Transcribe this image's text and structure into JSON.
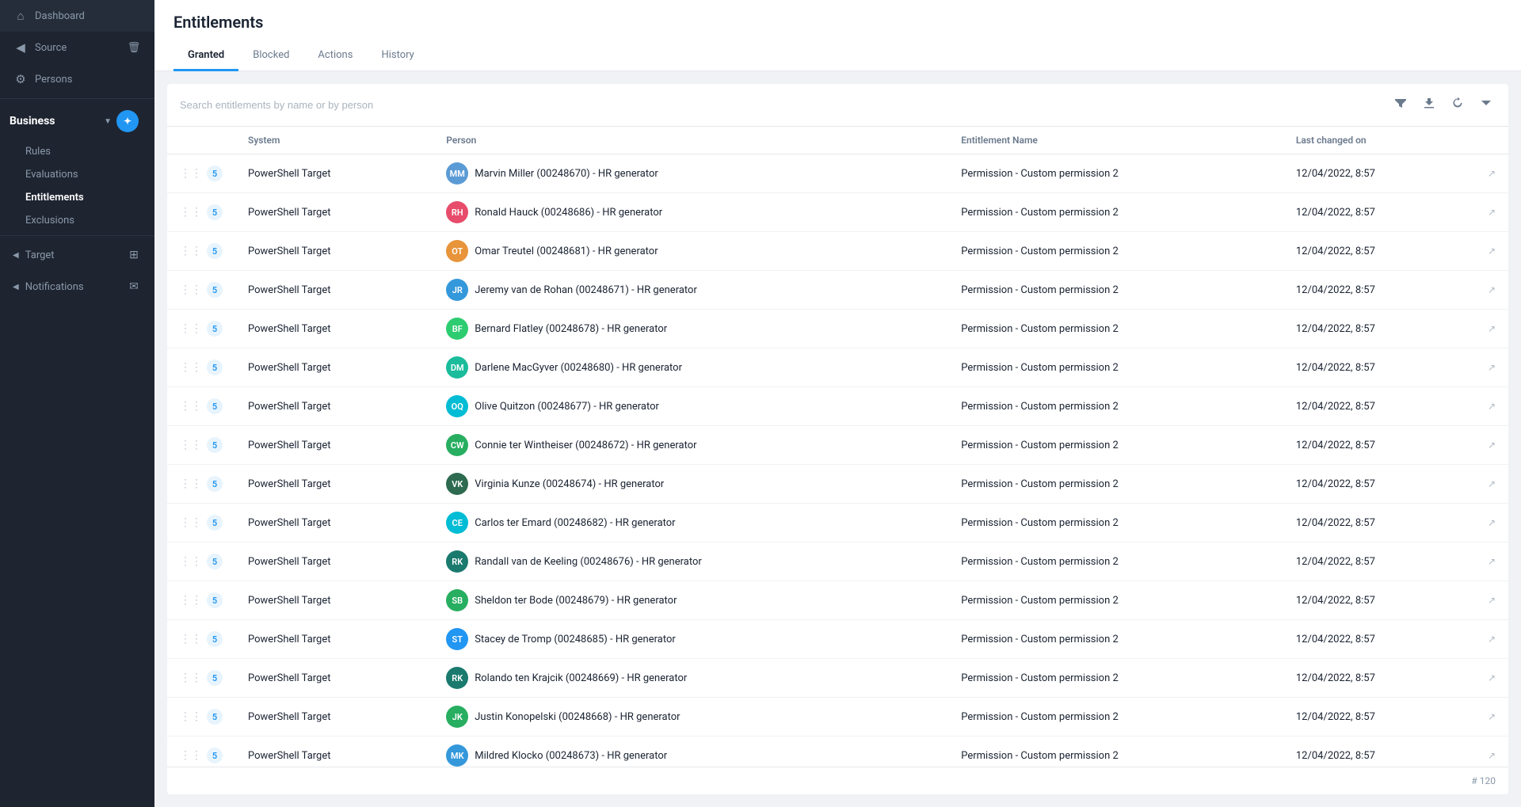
{
  "sidebar": {
    "items": [
      {
        "label": "Dashboard",
        "icon": "🏠",
        "id": "dashboard"
      },
      {
        "label": "Source",
        "icon": "◀",
        "id": "source",
        "hasIcon2": true,
        "icon2": "🗑"
      },
      {
        "label": "Persons",
        "icon": "⚙",
        "id": "persons"
      }
    ],
    "business": {
      "label": "Business",
      "icon": "circle-blue",
      "sub_items": [
        {
          "label": "Rules",
          "id": "rules"
        },
        {
          "label": "Evaluations",
          "id": "evaluations"
        },
        {
          "label": "Entitlements",
          "id": "entitlements",
          "active": true
        },
        {
          "label": "Exclusions",
          "id": "exclusions"
        }
      ]
    },
    "target": {
      "label": "Target",
      "id": "target"
    },
    "notifications": {
      "label": "Notifications",
      "id": "notifications"
    }
  },
  "page": {
    "title": "Entitlements",
    "tabs": [
      {
        "label": "Granted",
        "id": "granted",
        "active": true
      },
      {
        "label": "Blocked",
        "id": "blocked"
      },
      {
        "label": "Actions",
        "id": "actions"
      },
      {
        "label": "History",
        "id": "history"
      }
    ]
  },
  "search": {
    "placeholder": "Search entitlements by name or by person"
  },
  "table": {
    "columns": [
      "System",
      "Person",
      "Entitlement Name",
      "Last changed on"
    ],
    "rows": [
      {
        "system": "PowerShell Target",
        "avatar_initials": "MM",
        "avatar_color": "#5b9bd5",
        "person": "Marvin Miller (00248670) - HR generator",
        "entitlement": "Permission - Custom permission 2",
        "changed": "12/04/2022, 8:57"
      },
      {
        "system": "PowerShell Target",
        "avatar_initials": "RH",
        "avatar_color": "#e74c6b",
        "person": "Ronald Hauck (00248686) - HR generator",
        "entitlement": "Permission - Custom permission 2",
        "changed": "12/04/2022, 8:57"
      },
      {
        "system": "PowerShell Target",
        "avatar_initials": "OT",
        "avatar_color": "#e8943a",
        "person": "Omar Treutel (00248681) - HR generator",
        "entitlement": "Permission - Custom permission 2",
        "changed": "12/04/2022, 8:57"
      },
      {
        "system": "PowerShell Target",
        "avatar_initials": "JR",
        "avatar_color": "#3498db",
        "person": "Jeremy van de Rohan (00248671) - HR generator",
        "entitlement": "Permission - Custom permission 2",
        "changed": "12/04/2022, 8:57"
      },
      {
        "system": "PowerShell Target",
        "avatar_initials": "BF",
        "avatar_color": "#2ecc71",
        "person": "Bernard Flatley (00248678) - HR generator",
        "entitlement": "Permission - Custom permission 2",
        "changed": "12/04/2022, 8:57"
      },
      {
        "system": "PowerShell Target",
        "avatar_initials": "DM",
        "avatar_color": "#1abc9c",
        "person": "Darlene MacGyver (00248680) - HR generator",
        "entitlement": "Permission - Custom permission 2",
        "changed": "12/04/2022, 8:57"
      },
      {
        "system": "PowerShell Target",
        "avatar_initials": "OQ",
        "avatar_color": "#00bcd4",
        "person": "Olive Quitzon (00248677) - HR generator",
        "entitlement": "Permission - Custom permission 2",
        "changed": "12/04/2022, 8:57"
      },
      {
        "system": "PowerShell Target",
        "avatar_initials": "CW",
        "avatar_color": "#27ae60",
        "person": "Connie ter Wintheiser (00248672) - HR generator",
        "entitlement": "Permission - Custom permission 2",
        "changed": "12/04/2022, 8:57"
      },
      {
        "system": "PowerShell Target",
        "avatar_initials": "VK",
        "avatar_color": "#2d6a4f",
        "person": "Virginia Kunze (00248674) - HR generator",
        "entitlement": "Permission - Custom permission 2",
        "changed": "12/04/2022, 8:57"
      },
      {
        "system": "PowerShell Target",
        "avatar_initials": "CE",
        "avatar_color": "#00bcd4",
        "person": "Carlos ter Emard (00248682) - HR generator",
        "entitlement": "Permission - Custom permission 2",
        "changed": "12/04/2022, 8:57"
      },
      {
        "system": "PowerShell Target",
        "avatar_initials": "RK",
        "avatar_color": "#1a7a6e",
        "person": "Randall van de Keeling (00248676) - HR generator",
        "entitlement": "Permission - Custom permission 2",
        "changed": "12/04/2022, 8:57"
      },
      {
        "system": "PowerShell Target",
        "avatar_initials": "SB",
        "avatar_color": "#27ae60",
        "person": "Sheldon ter Bode (00248679) - HR generator",
        "entitlement": "Permission - Custom permission 2",
        "changed": "12/04/2022, 8:57"
      },
      {
        "system": "PowerShell Target",
        "avatar_initials": "ST",
        "avatar_color": "#2196f3",
        "person": "Stacey de Tromp (00248685) - HR generator",
        "entitlement": "Permission - Custom permission 2",
        "changed": "12/04/2022, 8:57"
      },
      {
        "system": "PowerShell Target",
        "avatar_initials": "RK",
        "avatar_color": "#1a7a6e",
        "person": "Rolando ten Krajcik (00248669) - HR generator",
        "entitlement": "Permission - Custom permission 2",
        "changed": "12/04/2022, 8:57"
      },
      {
        "system": "PowerShell Target",
        "avatar_initials": "JK",
        "avatar_color": "#27ae60",
        "person": "Justin Konopelski (00248668) - HR generator",
        "entitlement": "Permission - Custom permission 2",
        "changed": "12/04/2022, 8:57"
      },
      {
        "system": "PowerShell Target",
        "avatar_initials": "MK",
        "avatar_color": "#3498db",
        "person": "Mildred Klocko (00248673) - HR generator",
        "entitlement": "Permission - Custom permission 2",
        "changed": "12/04/2022, 8:57"
      }
    ],
    "footer": "# 120"
  }
}
